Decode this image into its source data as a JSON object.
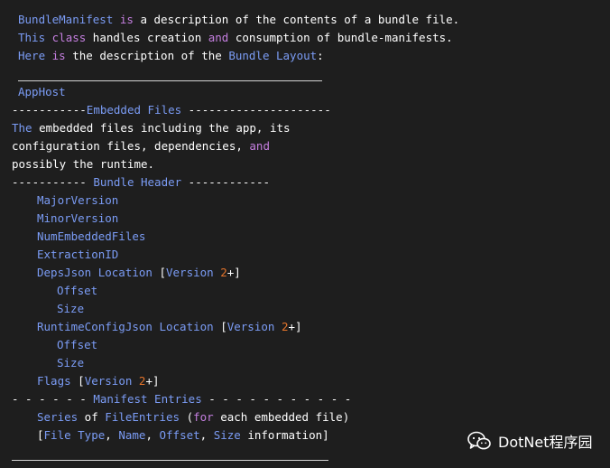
{
  "colors": {
    "background": "#1e1e1e",
    "plain": "#ffffff",
    "type": "#7b9cf5",
    "keyword": "#c57fe0",
    "number": "#e3732a",
    "rule": "#d4d4d4"
  },
  "lines": [
    {
      "indent": 20,
      "tokens": [
        {
          "t": "BundleManifest",
          "k": "type"
        },
        {
          "t": " ",
          "k": "plain"
        },
        {
          "t": "is",
          "k": "keyword"
        },
        {
          "t": " a description of the contents of a bundle file.",
          "k": "plain"
        }
      ]
    },
    {
      "indent": 20,
      "tokens": [
        {
          "t": "This",
          "k": "type"
        },
        {
          "t": " ",
          "k": "plain"
        },
        {
          "t": "class",
          "k": "keyword"
        },
        {
          "t": " handles creation ",
          "k": "plain"
        },
        {
          "t": "and",
          "k": "keyword"
        },
        {
          "t": " consumption of bundle-manifests.",
          "k": "plain"
        }
      ]
    },
    {
      "indent": 20,
      "tokens": [
        {
          "t": "Here",
          "k": "type"
        },
        {
          "t": " ",
          "k": "plain"
        },
        {
          "t": "is",
          "k": "keyword"
        },
        {
          "t": " the description of the ",
          "k": "plain"
        },
        {
          "t": "Bundle Layout",
          "k": "type"
        },
        {
          "t": ":",
          "k": "plain"
        }
      ]
    },
    {
      "indent": 20,
      "tokens": []
    },
    {
      "indent": 20,
      "tokens": [
        {
          "t": "AppHost",
          "k": "type"
        }
      ]
    },
    {
      "indent": 13,
      "tokens": [
        {
          "t": "-----------",
          "k": "plain"
        },
        {
          "t": "Embedded Files",
          "k": "type"
        },
        {
          "t": " ---------------------",
          "k": "plain"
        }
      ]
    },
    {
      "indent": 13,
      "tokens": [
        {
          "t": "The",
          "k": "type"
        },
        {
          "t": " embedded files including the app, its",
          "k": "plain"
        }
      ]
    },
    {
      "indent": 13,
      "tokens": [
        {
          "t": "configuration files, dependencies, ",
          "k": "plain"
        },
        {
          "t": "and",
          "k": "keyword"
        }
      ]
    },
    {
      "indent": 13,
      "tokens": [
        {
          "t": "possibly the runtime.",
          "k": "plain"
        }
      ]
    },
    {
      "indent": 13,
      "tokens": [
        {
          "t": "----------- ",
          "k": "plain"
        },
        {
          "t": "Bundle Header",
          "k": "type"
        },
        {
          "t": " ------------",
          "k": "plain"
        }
      ]
    },
    {
      "indent": 41,
      "tokens": [
        {
          "t": "MajorVersion",
          "k": "type"
        }
      ]
    },
    {
      "indent": 41,
      "tokens": [
        {
          "t": "MinorVersion",
          "k": "type"
        }
      ]
    },
    {
      "indent": 41,
      "tokens": [
        {
          "t": "NumEmbeddedFiles",
          "k": "type"
        }
      ]
    },
    {
      "indent": 41,
      "tokens": [
        {
          "t": "ExtractionID",
          "k": "type"
        }
      ]
    },
    {
      "indent": 41,
      "tokens": [
        {
          "t": "DepsJson Location",
          "k": "type"
        },
        {
          "t": " [",
          "k": "plain"
        },
        {
          "t": "Version",
          "k": "type"
        },
        {
          "t": " ",
          "k": "plain"
        },
        {
          "t": "2",
          "k": "number"
        },
        {
          "t": "+]",
          "k": "plain"
        }
      ]
    },
    {
      "indent": 63,
      "tokens": [
        {
          "t": "Offset",
          "k": "type"
        }
      ]
    },
    {
      "indent": 63,
      "tokens": [
        {
          "t": "Size",
          "k": "type"
        }
      ]
    },
    {
      "indent": 41,
      "tokens": [
        {
          "t": "RuntimeConfigJson Location",
          "k": "type"
        },
        {
          "t": " [",
          "k": "plain"
        },
        {
          "t": "Version",
          "k": "type"
        },
        {
          "t": " ",
          "k": "plain"
        },
        {
          "t": "2",
          "k": "number"
        },
        {
          "t": "+]",
          "k": "plain"
        }
      ]
    },
    {
      "indent": 63,
      "tokens": [
        {
          "t": "Offset",
          "k": "type"
        }
      ]
    },
    {
      "indent": 63,
      "tokens": [
        {
          "t": "Size",
          "k": "type"
        }
      ]
    },
    {
      "indent": 41,
      "tokens": [
        {
          "t": "Flags",
          "k": "type"
        },
        {
          "t": " [",
          "k": "plain"
        },
        {
          "t": "Version",
          "k": "type"
        },
        {
          "t": " ",
          "k": "plain"
        },
        {
          "t": "2",
          "k": "number"
        },
        {
          "t": "+]",
          "k": "plain"
        }
      ]
    },
    {
      "indent": 13,
      "tokens": [
        {
          "t": "- - - - - - ",
          "k": "plain"
        },
        {
          "t": "Manifest Entries",
          "k": "type"
        },
        {
          "t": " - - - - - - - - - - -",
          "k": "plain"
        }
      ]
    },
    {
      "indent": 41,
      "tokens": [
        {
          "t": "Series",
          "k": "type"
        },
        {
          "t": " of ",
          "k": "plain"
        },
        {
          "t": "FileEntries",
          "k": "type"
        },
        {
          "t": " (",
          "k": "plain"
        },
        {
          "t": "for",
          "k": "keyword"
        },
        {
          "t": " each embedded file)",
          "k": "plain"
        }
      ]
    },
    {
      "indent": 41,
      "tokens": [
        {
          "t": "[",
          "k": "plain"
        },
        {
          "t": "File Type",
          "k": "type"
        },
        {
          "t": ", ",
          "k": "plain"
        },
        {
          "t": "Name",
          "k": "type"
        },
        {
          "t": ", ",
          "k": "plain"
        },
        {
          "t": "Offset",
          "k": "type"
        },
        {
          "t": ", ",
          "k": "plain"
        },
        {
          "t": "Size",
          "k": "type"
        },
        {
          "t": " information]",
          "k": "plain"
        }
      ]
    }
  ],
  "watermark": {
    "icon": "wechat-icon",
    "text": "DotNet程序园"
  }
}
